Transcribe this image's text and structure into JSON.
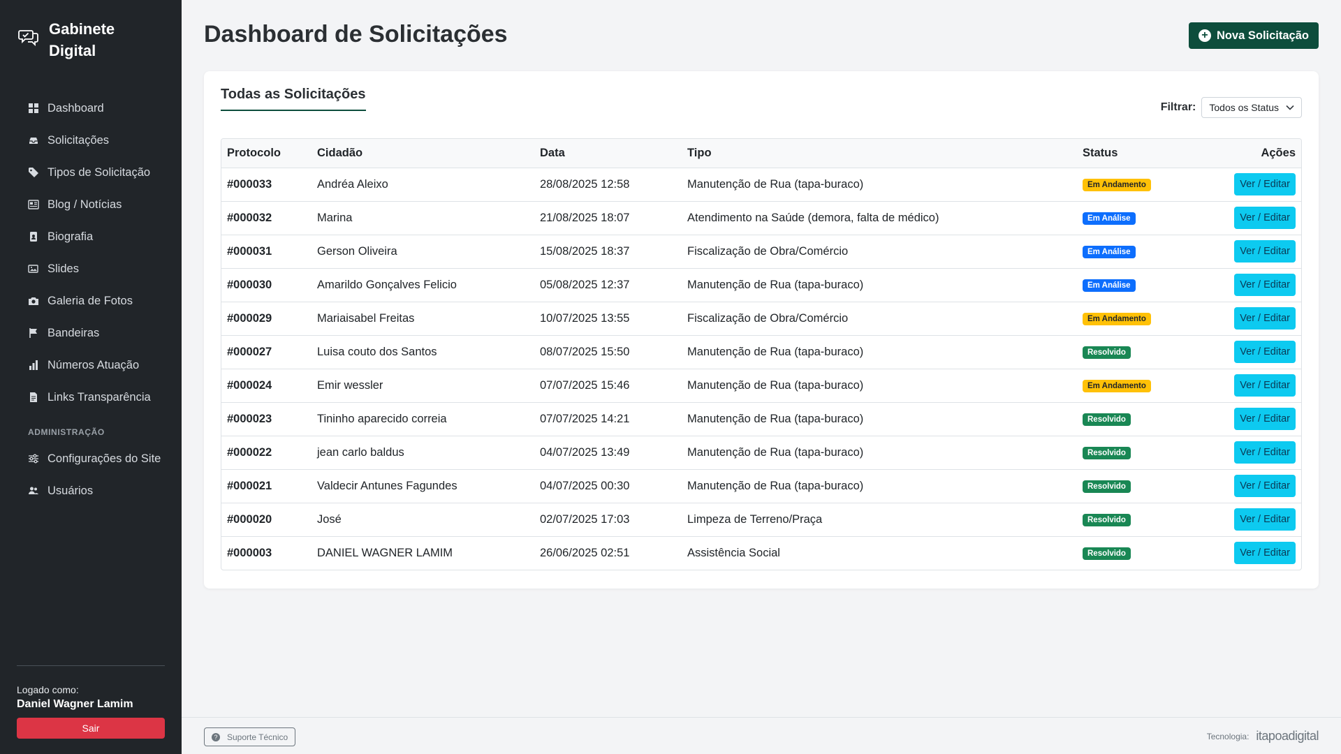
{
  "app": {
    "name": "Gabinete Digital"
  },
  "sidebar": {
    "items": [
      {
        "label": "Dashboard",
        "icon": "grid-icon"
      },
      {
        "label": "Solicitações",
        "icon": "inbox-icon"
      },
      {
        "label": "Tipos de Solicitação",
        "icon": "tag-icon"
      },
      {
        "label": "Blog / Notícias",
        "icon": "newspaper-icon"
      },
      {
        "label": "Biografia",
        "icon": "person-badge-icon"
      },
      {
        "label": "Slides",
        "icon": "images-icon"
      },
      {
        "label": "Galeria de Fotos",
        "icon": "camera-icon"
      },
      {
        "label": "Bandeiras",
        "icon": "flag-icon"
      },
      {
        "label": "Números Atuação",
        "icon": "bar-chart-icon"
      },
      {
        "label": "Links Transparência",
        "icon": "file-icon"
      }
    ],
    "admin_section": "ADMINISTRAÇÃO",
    "admin_items": [
      {
        "label": "Configurações do Site",
        "icon": "sliders-icon"
      },
      {
        "label": "Usuários",
        "icon": "users-icon"
      }
    ],
    "logged_as_label": "Logado como:",
    "user_name": "Daniel Wagner Lamim",
    "logout_label": "Sair"
  },
  "header": {
    "title": "Dashboard de Solicitações",
    "new_button_label": "Nova Solicitação"
  },
  "card": {
    "title": "Todas as Solicitações",
    "filter_label": "Filtrar:",
    "filter_value": "Todos os Status"
  },
  "table": {
    "columns": [
      "Protocolo",
      "Cidadão",
      "Data",
      "Tipo",
      "Status",
      "Ações"
    ],
    "action_label": "Ver / Editar",
    "rows": [
      {
        "protocolo": "#000033",
        "cidadao": "Andréa Aleixo",
        "data": "28/08/2025 12:58",
        "tipo": "Manutenção de Rua (tapa-buraco)",
        "status": "Em Andamento",
        "status_kind": "andamento"
      },
      {
        "protocolo": "#000032",
        "cidadao": "Marina",
        "data": "21/08/2025 18:07",
        "tipo": "Atendimento na Saúde (demora, falta de médico)",
        "status": "Em Análise",
        "status_kind": "analise"
      },
      {
        "protocolo": "#000031",
        "cidadao": "Gerson Oliveira",
        "data": "15/08/2025 18:37",
        "tipo": "Fiscalização de Obra/Comércio",
        "status": "Em Análise",
        "status_kind": "analise"
      },
      {
        "protocolo": "#000030",
        "cidadao": "Amarildo Gonçalves Felicio",
        "data": "05/08/2025 12:37",
        "tipo": "Manutenção de Rua (tapa-buraco)",
        "status": "Em Análise",
        "status_kind": "analise"
      },
      {
        "protocolo": "#000029",
        "cidadao": "Mariaisabel Freitas",
        "data": "10/07/2025 13:55",
        "tipo": "Fiscalização de Obra/Comércio",
        "status": "Em Andamento",
        "status_kind": "andamento"
      },
      {
        "protocolo": "#000027",
        "cidadao": "Luisa couto dos Santos",
        "data": "08/07/2025 15:50",
        "tipo": "Manutenção de Rua (tapa-buraco)",
        "status": "Resolvido",
        "status_kind": "resolvido"
      },
      {
        "protocolo": "#000024",
        "cidadao": "Emir wessler",
        "data": "07/07/2025 15:46",
        "tipo": "Manutenção de Rua (tapa-buraco)",
        "status": "Em Andamento",
        "status_kind": "andamento"
      },
      {
        "protocolo": "#000023",
        "cidadao": "Tininho aparecido correia",
        "data": "07/07/2025 14:21",
        "tipo": "Manutenção de Rua (tapa-buraco)",
        "status": "Resolvido",
        "status_kind": "resolvido"
      },
      {
        "protocolo": "#000022",
        "cidadao": "jean carlo baldus",
        "data": "04/07/2025 13:49",
        "tipo": "Manutenção de Rua (tapa-buraco)",
        "status": "Resolvido",
        "status_kind": "resolvido"
      },
      {
        "protocolo": "#000021",
        "cidadao": "Valdecir Antunes Fagundes",
        "data": "04/07/2025 00:30",
        "tipo": "Manutenção de Rua (tapa-buraco)",
        "status": "Resolvido",
        "status_kind": "resolvido"
      },
      {
        "protocolo": "#000020",
        "cidadao": "José",
        "data": "02/07/2025 17:03",
        "tipo": "Limpeza de Terreno/Praça",
        "status": "Resolvido",
        "status_kind": "resolvido"
      },
      {
        "protocolo": "#000003",
        "cidadao": "DANIEL WAGNER LAMIM",
        "data": "26/06/2025 02:51",
        "tipo": "Assistência Social",
        "status": "Resolvido",
        "status_kind": "resolvido"
      }
    ]
  },
  "footer": {
    "support_label": "Suporte Técnico",
    "tech_label": "Tecnologia:",
    "tech_brand": "itapoadigital"
  },
  "colors": {
    "sidebar_bg": "#212529",
    "accent": "#0d4d3c",
    "status_andamento": "#ffc107",
    "status_analise": "#0d6efd",
    "status_resolvido": "#198754",
    "action_button": "#0dcaf0",
    "logout": "#dc3545"
  }
}
